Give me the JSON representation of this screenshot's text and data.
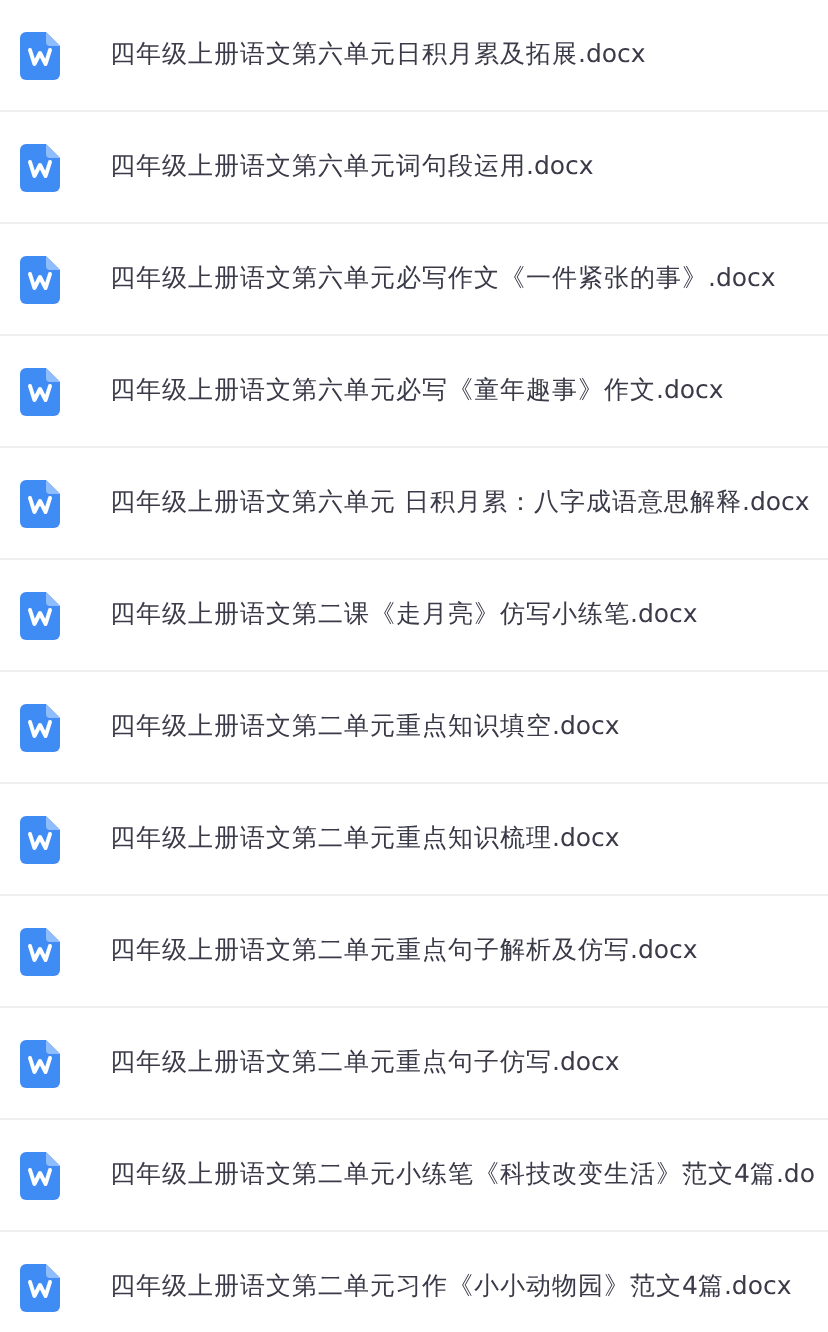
{
  "files": [
    {
      "name": "四年级上册语文第六单元日积月累及拓展.docx"
    },
    {
      "name": "四年级上册语文第六单元词句段运用.docx"
    },
    {
      "name": "四年级上册语文第六单元必写作文《一件紧张的事》.docx"
    },
    {
      "name": "四年级上册语文第六单元必写《童年趣事》作文.docx"
    },
    {
      "name": "四年级上册语文第六单元 日积月累：八字成语意思解释.docx"
    },
    {
      "name": "四年级上册语文第二课《走月亮》仿写小练笔.docx"
    },
    {
      "name": "四年级上册语文第二单元重点知识填空.docx"
    },
    {
      "name": "四年级上册语文第二单元重点知识梳理.docx"
    },
    {
      "name": "四年级上册语文第二单元重点句子解析及仿写.docx"
    },
    {
      "name": "四年级上册语文第二单元重点句子仿写.docx"
    },
    {
      "name": "四年级上册语文第二单元小练笔《科技改变生活》范文4篇.do"
    },
    {
      "name": "四年级上册语文第二单元习作《小小动物园》范文4篇.docx"
    }
  ]
}
